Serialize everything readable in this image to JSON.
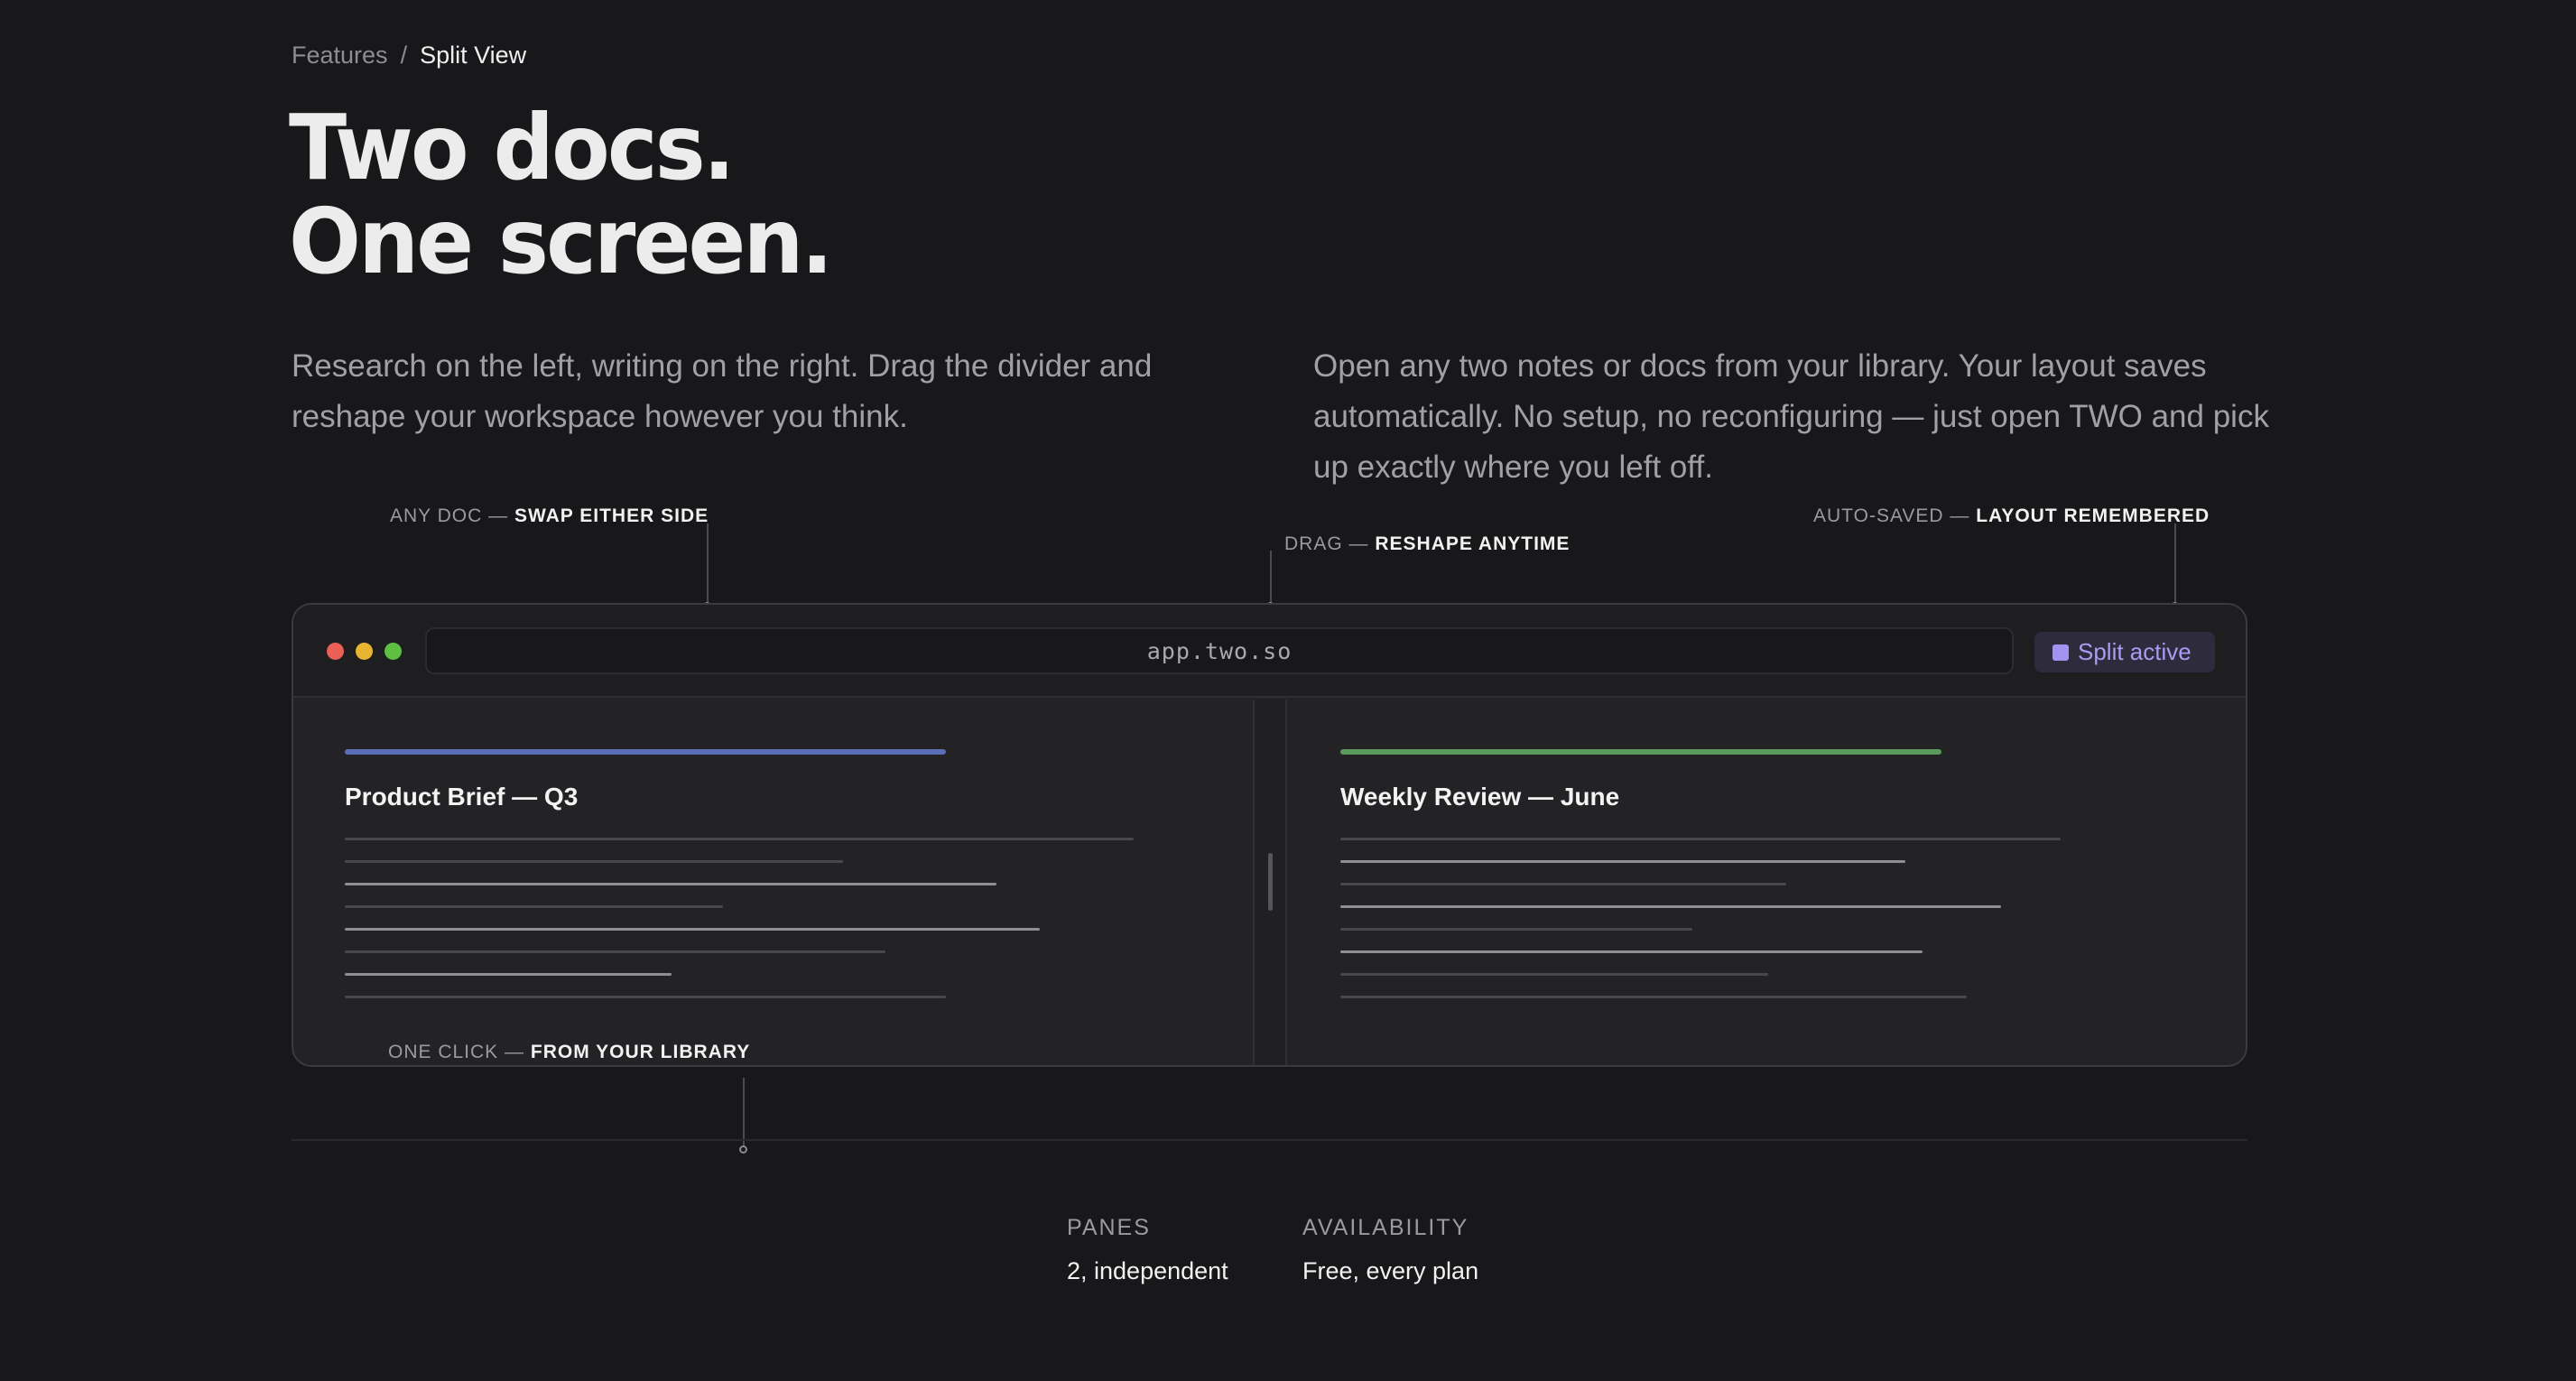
{
  "breadcrumb": {
    "parent": "Features",
    "separator": "/",
    "current": "Split View"
  },
  "headline": {
    "line1": "Two docs.",
    "line2": "One screen."
  },
  "intro": {
    "left": "Research on the left, writing on the right. Drag the divider and reshape your workspace however you think.",
    "right": "Open any two notes or docs from your library. Your layout saves automatically. No setup, no reconfiguring — just open TWO and pick up exactly where you left off."
  },
  "callouts": {
    "any_doc": {
      "prefix": "ANY DOC — ",
      "strong": "SWAP EITHER SIDE"
    },
    "drag": {
      "prefix": "DRAG — ",
      "strong": "RESHAPE ANYTIME"
    },
    "auto_saved": {
      "prefix": "AUTO-SAVED — ",
      "strong": "LAYOUT REMEMBERED"
    },
    "one_click": {
      "prefix": "ONE CLICK — ",
      "strong": "FROM YOUR LIBRARY"
    }
  },
  "window": {
    "address": "app.two.so",
    "badge": "Split active",
    "left_pane": {
      "title": "Product Brief — Q3",
      "accent": "#5a6fb8"
    },
    "right_pane": {
      "title": "Weekly Review — June",
      "accent": "#5b9a5c"
    }
  },
  "stats": [
    {
      "label": "PANES",
      "value": "2, independent"
    },
    {
      "label": "AVAILABILITY",
      "value": "Free, every plan"
    }
  ],
  "colors": {
    "background": "#18181a",
    "traffic_red": "#ec5f57",
    "traffic_yellow": "#e8b431",
    "traffic_green": "#5dc042",
    "badge_accent": "#a99cf2"
  }
}
